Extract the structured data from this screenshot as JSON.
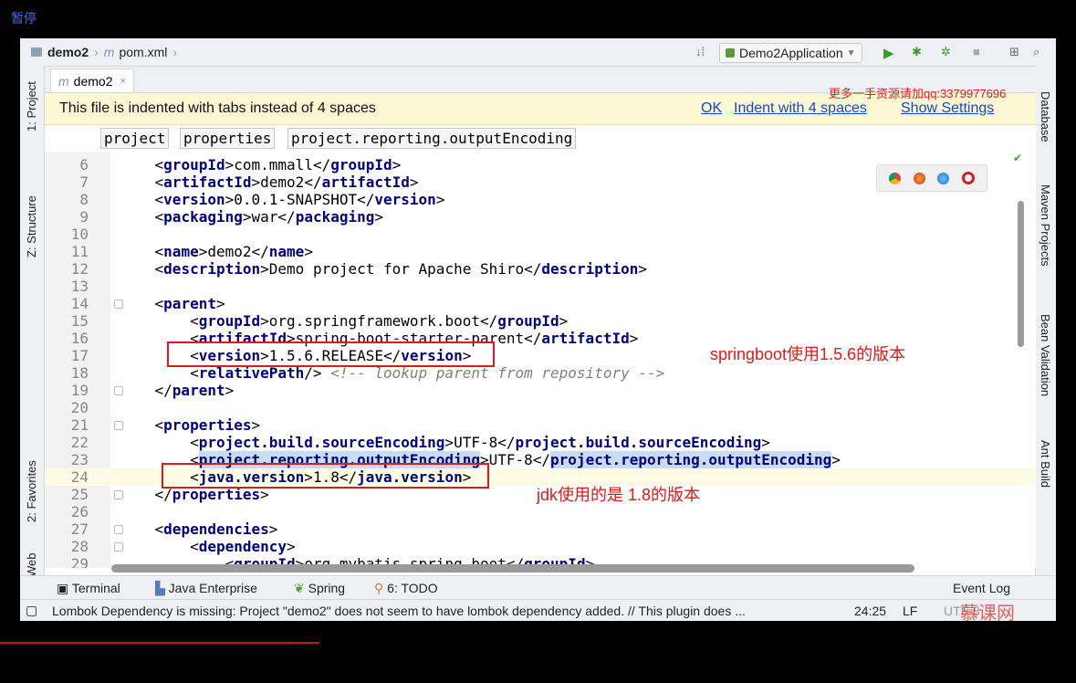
{
  "overlay": {
    "pause_label": "暂停"
  },
  "navbar": {
    "project": "demo2",
    "file": "pom.xml",
    "run_config": "Demo2Application"
  },
  "tabs": [
    {
      "label": "demo2"
    }
  ],
  "left_tools": {
    "project": "1: Project",
    "structure": "Z: Structure",
    "favorites": "2: Favorites",
    "web": "Web"
  },
  "right_tools": {
    "database": "Database",
    "maven": "Maven Projects",
    "bean": "Bean Validation",
    "ant": "Ant Build"
  },
  "banner": {
    "message": "This file is indented with tabs instead of 4 spaces",
    "ok": "OK",
    "indent": "Indent with 4 spaces",
    "settings": "Show Settings"
  },
  "watermark": "更多一手资源请加qq:3379977696",
  "breadcrumbs": [
    "project",
    "properties",
    "project.reporting.outputEncoding"
  ],
  "code_lines": [
    {
      "n": "6",
      "indent": "    ",
      "open": "groupId",
      "text": "com.mmall",
      "close": "groupId"
    },
    {
      "n": "7",
      "indent": "    ",
      "open": "artifactId",
      "text": "demo2",
      "close": "artifactId"
    },
    {
      "n": "8",
      "indent": "    ",
      "open": "version",
      "text": "0.0.1-SNAPSHOT",
      "close": "version"
    },
    {
      "n": "9",
      "indent": "    ",
      "open": "packaging",
      "text": "war",
      "close": "packaging"
    },
    {
      "n": "10"
    },
    {
      "n": "11",
      "indent": "    ",
      "open": "name",
      "text": "demo2",
      "close": "name"
    },
    {
      "n": "12",
      "indent": "    ",
      "open": "description",
      "text": "Demo project for Apache Shiro",
      "close": "description"
    },
    {
      "n": "13"
    },
    {
      "n": "14",
      "indent": "    ",
      "open": "parent",
      "fold": true
    },
    {
      "n": "15",
      "indent": "        ",
      "open": "groupId",
      "text": "org.springframework.boot",
      "close": "groupId"
    },
    {
      "n": "16",
      "indent": "        ",
      "open": "artifactId",
      "text": "spring-boot-starter-parent",
      "close": "artifactId"
    },
    {
      "n": "17",
      "indent": "        ",
      "open": "version",
      "text": "1.5.6.RELEASE",
      "close": "version"
    },
    {
      "n": "18",
      "indent": "        ",
      "selfclose": "relativePath",
      "comment": "<!-- lookup parent from repository -->"
    },
    {
      "n": "19",
      "indent": "    ",
      "close": "parent",
      "fold": true
    },
    {
      "n": "20"
    },
    {
      "n": "21",
      "indent": "    ",
      "open": "properties",
      "fold": true
    },
    {
      "n": "22",
      "indent": "        ",
      "open": "project.build.sourceEncoding",
      "text": "UTF-8",
      "close": "project.build.sourceEncoding"
    },
    {
      "n": "23",
      "indent": "        ",
      "open": "project.reporting.outputEncoding",
      "text": "UTF-8",
      "close": "project.reporting.outputEncoding",
      "highlight": true
    },
    {
      "n": "24",
      "indent": "        ",
      "open": "java.version",
      "text": "1.8",
      "close": "java.version",
      "current": true
    },
    {
      "n": "25",
      "indent": "    ",
      "close": "properties",
      "fold": true
    },
    {
      "n": "26"
    },
    {
      "n": "27",
      "indent": "    ",
      "open": "dependencies",
      "fold": true
    },
    {
      "n": "28",
      "indent": "        ",
      "open": "dependency",
      "fold": true
    },
    {
      "n": "29",
      "indent": "            ",
      "open": "groupId",
      "text": "org.mybatis.spring.boot",
      "close": "groupId"
    }
  ],
  "annotations": {
    "springboot": "springboot使用1.5.6的版本",
    "jdk": "jdk使用的是  1.8的版本"
  },
  "toolwindows": {
    "terminal": "Terminal",
    "java_ee": "Java Enterprise",
    "spring": "Spring",
    "todo": "6: TODO",
    "event_log": "Event Log"
  },
  "status": {
    "message": "Lombok Dependency is missing: Project \"demo2\" does not seem to have lombok dependency added. // This plugin does ...",
    "position": "24:25",
    "line_sep": "LF",
    "encoding": "UTF-8"
  },
  "logo_text": "慕课网",
  "colors": {
    "accent_red": "#e01a1a",
    "tag_blue": "#000080",
    "link_blue": "#1a46c9",
    "banner_bg": "#fdf8d4"
  }
}
